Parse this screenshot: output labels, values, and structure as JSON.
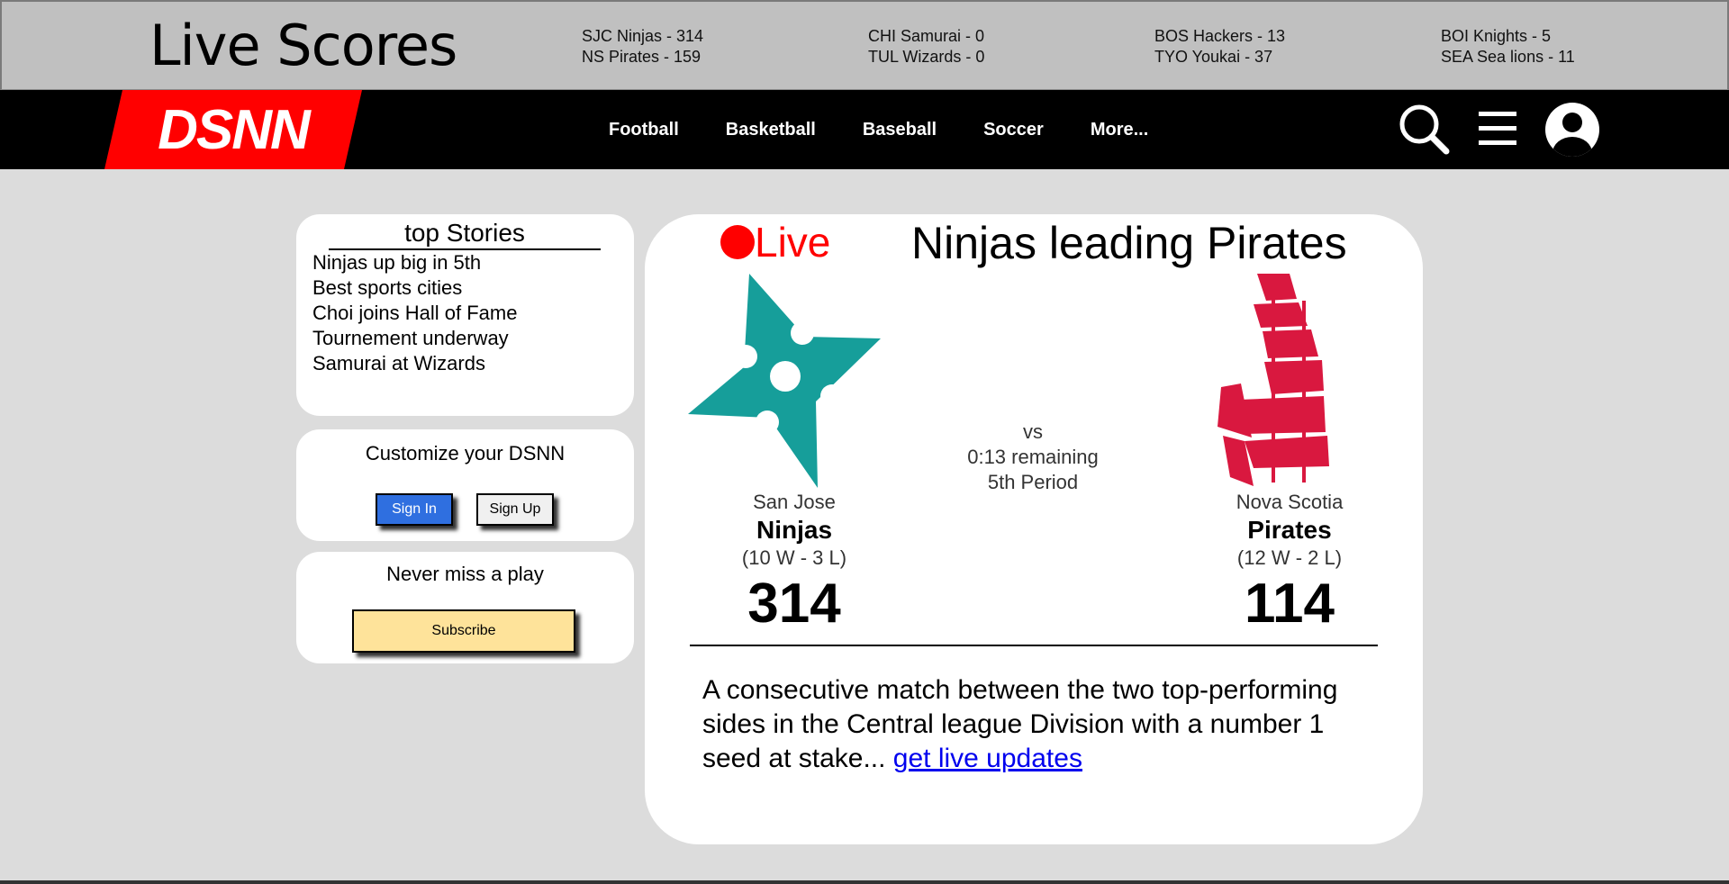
{
  "scores_bar": {
    "title": "Live Scores",
    "games": [
      {
        "line1": "SJC Ninjas - 314",
        "line2": "NS Pirates - 159"
      },
      {
        "line1": "CHI Samurai - 0",
        "line2": "TUL Wizards - 0"
      },
      {
        "line1": "BOS Hackers - 13",
        "line2": "TYO Youkai - 37"
      },
      {
        "line1": "BOI Knights - 5",
        "line2": "SEA Sea lions - 11"
      }
    ]
  },
  "nav": {
    "logo": "DSNN",
    "links": [
      "Football",
      "Basketball",
      "Baseball",
      "Soccer",
      "More..."
    ],
    "icons": [
      "search-icon",
      "menu-icon",
      "user-icon"
    ]
  },
  "top_stories": {
    "title": "top Stories",
    "items": [
      "Ninjas up big in 5th",
      "Best sports cities",
      "Choi joins Hall of Fame",
      "Tournement underway",
      "Samurai at Wizards"
    ]
  },
  "customize": {
    "title": "Customize your DSNN",
    "sign_in": "Sign In",
    "sign_up": "Sign Up"
  },
  "subscribe": {
    "title": "Never miss a play",
    "button": "Subscribe"
  },
  "match": {
    "live_label": "Live",
    "title": "Ninjas leading Pirates",
    "vs": "vs",
    "remaining": "0:13 remaining",
    "period": "5th Period",
    "home": {
      "city": "San Jose",
      "name": "Ninjas",
      "record": "(10 W - 3 L)",
      "score": "314",
      "logo": "ninja-star-logo"
    },
    "away": {
      "city": "Nova Scotia",
      "name": "Pirates",
      "record": "(12 W - 2 L)",
      "score": "114",
      "logo": "pirate-ship-logo"
    },
    "description": "A consecutive match between the two top-performing sides in the Central league Division with a number 1 seed at stake...",
    "link": "get live updates"
  },
  "colors": {
    "logo_red": "#ff0000",
    "ninja_teal": "#169e9a",
    "pirate_red": "#d9183f",
    "signin_blue": "#2f6fe0",
    "subscribe_yellow": "#fee39a",
    "link_blue": "#0000ee"
  }
}
